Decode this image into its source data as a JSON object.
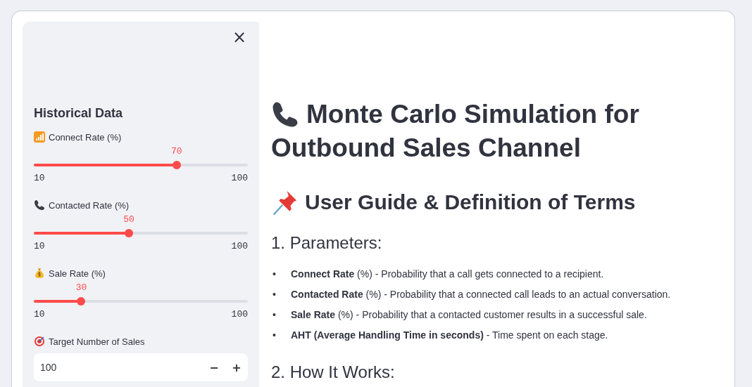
{
  "sidebar": {
    "close_label": "×",
    "section_title": "Historical Data",
    "sliders": [
      {
        "label": "Connect Rate (%)",
        "value": "70",
        "min": "10",
        "max": "100",
        "level": 0.667
      },
      {
        "label": "Contacted Rate (%)",
        "value": "50",
        "min": "10",
        "max": "100",
        "level": 0.444
      },
      {
        "label": "Sale Rate (%)",
        "value": "30",
        "min": "10",
        "max": "100",
        "level": 0.222
      }
    ],
    "number_input": {
      "label": "Target Number of Sales",
      "value": "100",
      "decrement": "−",
      "increment": "+"
    }
  },
  "main": {
    "title_lines": [
      "Monte Carlo Simulation for",
      "Outbound Sales Channel"
    ],
    "guide_heading": "User Guide & Definition of Terms",
    "sections": [
      {
        "heading": "1. Parameters:",
        "bullets": [
          {
            "marker": "•",
            "text": "**Connect Rate** (%) - Probability that a call gets connected to a recipient."
          },
          {
            "marker": "•",
            "text": "**Contacted Rate** (%) - Probability that a connected call leads to an actual conversation."
          },
          {
            "marker": "•",
            "text": "**Sale Rate** (%) - Probability that a contacted customer results in a successful sale."
          },
          {
            "marker": "•",
            "text": "**AHT (Average Handling Time in seconds)** - Time spent on each stage."
          }
        ]
      },
      {
        "heading": "2. How It Works:"
      }
    ]
  }
}
